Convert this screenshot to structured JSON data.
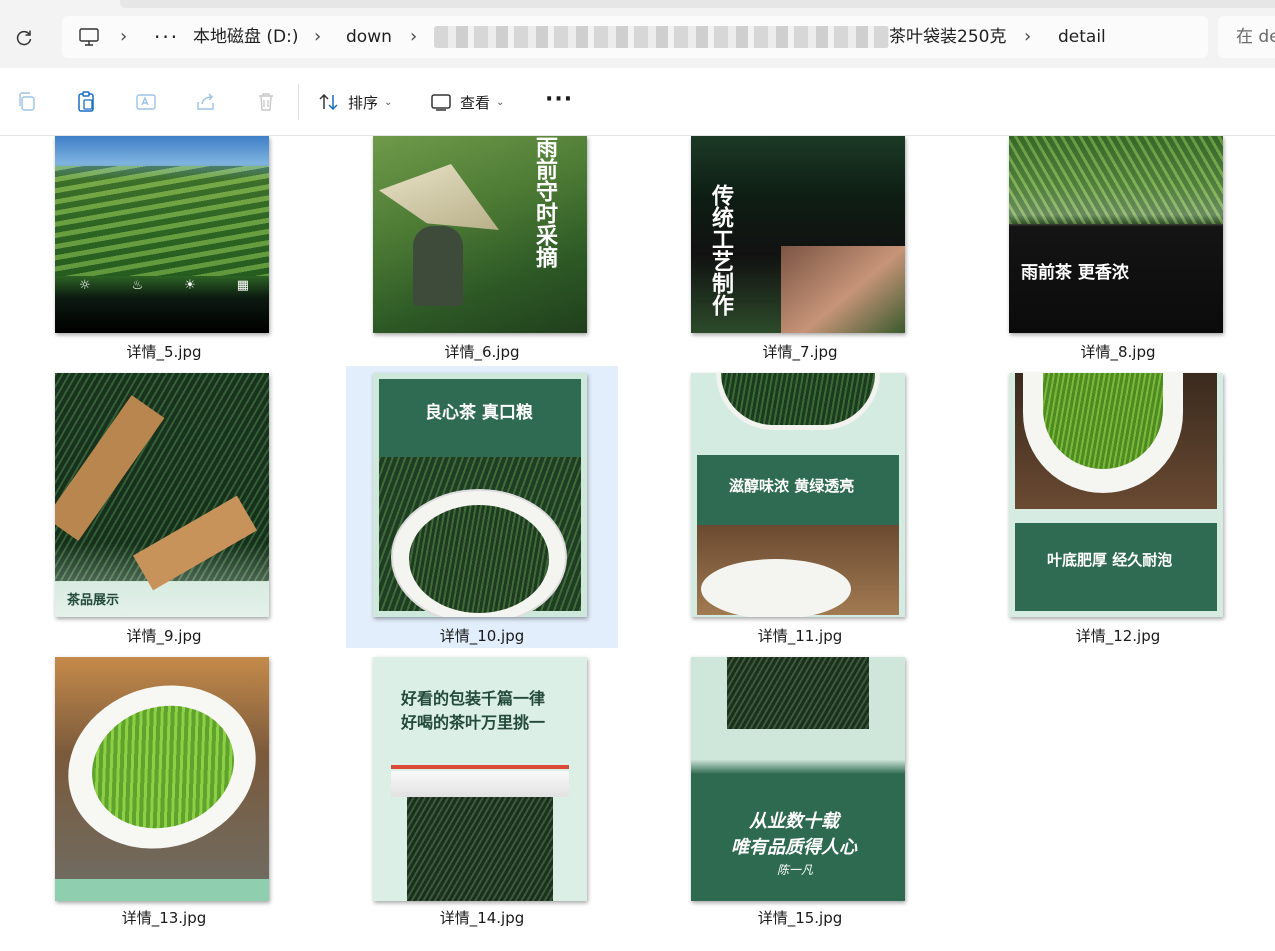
{
  "address_bar": {
    "crumbs": [
      "本地磁盘 (D:)",
      "down"
    ],
    "folder_tail": "茶叶袋装250克",
    "current": "detail",
    "search_placeholder": "在 de"
  },
  "toolbar": {
    "sort_label": "排序",
    "view_label": "查看",
    "more_label": "···"
  },
  "files": [
    {
      "name": "详情_5.jpg"
    },
    {
      "name": "详情_6.jpg",
      "text_main": "雨前守时采摘"
    },
    {
      "name": "详情_7.jpg",
      "text_main": "传统工艺制作"
    },
    {
      "name": "详情_8.jpg",
      "text_main": "雨前茶 更香浓"
    },
    {
      "name": "详情_9.jpg",
      "text_main": "茶品展示"
    },
    {
      "name": "详情_10.jpg",
      "selected": true,
      "text_main": "良心茶 真口粮"
    },
    {
      "name": "详情_11.jpg",
      "text_main": "滋醇味浓 黄绿透亮"
    },
    {
      "name": "详情_12.jpg",
      "text_main": "叶底肥厚 经久耐泡"
    },
    {
      "name": "详情_13.jpg"
    },
    {
      "name": "详情_14.jpg",
      "text_main": "好看的包装千篇一律",
      "text_sub": "好喝的茶叶万里挑一"
    },
    {
      "name": "详情_15.jpg",
      "text_main": "从业数十载",
      "text_sub": "唯有品质得人心",
      "text_sign": "陈一凡"
    }
  ],
  "colors": {
    "accent": "#0067c0",
    "selection": "#e2eefb",
    "tea_green": "#2c6b52"
  }
}
